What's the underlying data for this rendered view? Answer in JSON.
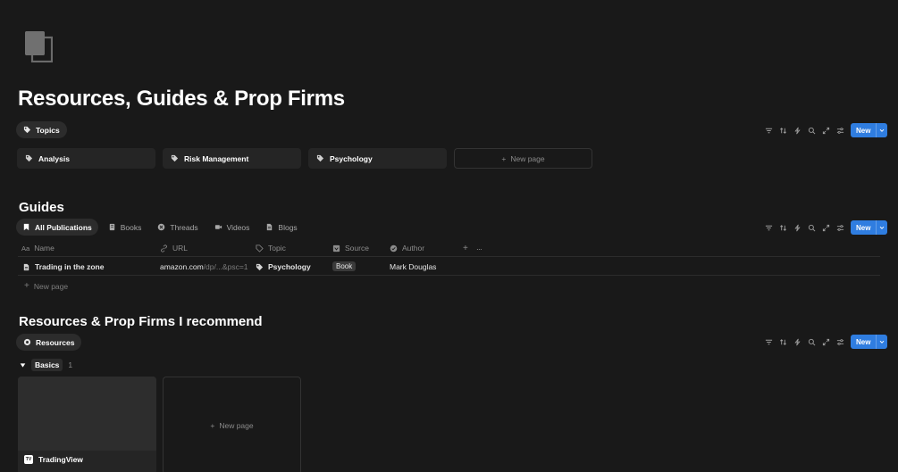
{
  "page": {
    "icon": "stacked-pages-icon",
    "title": "Resources, Guides & Prop Firms"
  },
  "colors": {
    "background": "#191919",
    "accent": "#2f7de0",
    "card": "#252525",
    "pill": "#2c2c2c"
  },
  "toolbar": {
    "icons": [
      "filter-icon",
      "sort-icon",
      "automation-icon",
      "search-icon",
      "expand-icon",
      "settings-icon"
    ],
    "new_label": "New"
  },
  "topics": {
    "view_label": "Topics",
    "cards": [
      {
        "label": "Analysis",
        "icon": "tag-icon"
      },
      {
        "label": "Risk Management",
        "icon": "tag-icon"
      },
      {
        "label": "Psychology",
        "icon": "tag-icon"
      }
    ],
    "new_page_label": "New page"
  },
  "guides": {
    "title": "Guides",
    "tabs": [
      {
        "label": "All Publications",
        "icon": "bookmark-icon",
        "active": true
      },
      {
        "label": "Books",
        "icon": "book-icon",
        "active": false
      },
      {
        "label": "Threads",
        "icon": "x-logo-icon",
        "active": false
      },
      {
        "label": "Videos",
        "icon": "video-icon",
        "active": false
      },
      {
        "label": "Blogs",
        "icon": "document-icon",
        "active": false
      }
    ],
    "columns": [
      {
        "label": "Name",
        "icon": "text-icon"
      },
      {
        "label": "URL",
        "icon": "link-icon"
      },
      {
        "label": "Topic",
        "icon": "tag-icon"
      },
      {
        "label": "Source",
        "icon": "select-icon"
      },
      {
        "label": "Author",
        "icon": "check-circle-icon"
      }
    ],
    "rows": [
      {
        "name": "Trading in the zone",
        "url_main": "amazon.com",
        "url_rest": "/dp/...&psc=1",
        "topic": "Psychology",
        "source": "Book",
        "author": "Mark Douglas"
      }
    ],
    "new_page_label": "New page"
  },
  "resources": {
    "title": "Resources & Prop Firms I recommend",
    "view_label": "Resources",
    "group": {
      "label": "Basics",
      "count": "1"
    },
    "cards": [
      {
        "label": "TradingView",
        "logo_text": "TV"
      }
    ],
    "new_page_label": "New page"
  }
}
